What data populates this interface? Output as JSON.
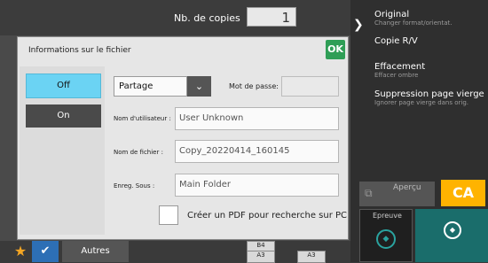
{
  "background": {
    "copies_label": "Nb. de copies",
    "copies_value": "1",
    "right_panel": {
      "items": [
        {
          "title": "Original",
          "sub": "Changer format/orientat."
        },
        {
          "title": "Copie R/V",
          "sub": ""
        },
        {
          "title": "Effacement",
          "sub": "Effacer ombre"
        },
        {
          "title": "Suppression page vierge",
          "sub": "Ignorer page vierge dans orig."
        }
      ],
      "apercu_label": "Aperçu",
      "ca_label": "CA",
      "epreuve_label": "Epreuve"
    },
    "bottombar": {
      "autres_label": "Autres"
    },
    "thumbs": [
      "B4",
      "A3",
      "A3"
    ]
  },
  "dialog": {
    "title": "Informations sur le fichier",
    "ok_label": "OK",
    "off_label": "Off",
    "on_label": "On",
    "share_value": "Partage",
    "password_label": "Mot de passe",
    "rows": [
      {
        "label": "Nom d'utilisateur",
        "value": "User Unknown"
      },
      {
        "label": "Nom de fichier",
        "value": "Copy_20220414_160145"
      },
      {
        "label": "Enreg. Sous",
        "value": "Main Folder"
      }
    ],
    "pdf_label": "Créer un PDF pour recherche sur PC"
  }
}
